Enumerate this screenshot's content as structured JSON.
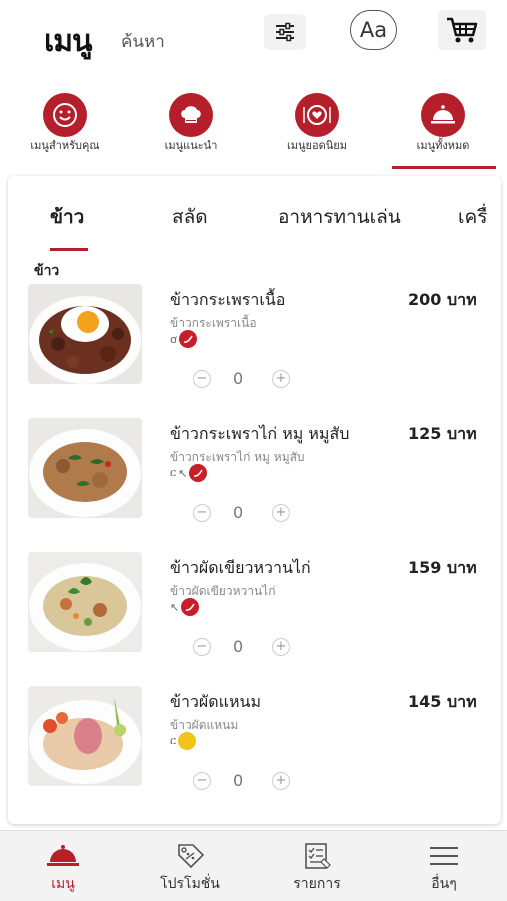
{
  "header": {
    "title": "เมนู",
    "search_label": "ค้นหา",
    "font_button_label": "Aa",
    "icons": {
      "filter": "sliders-icon",
      "font": "font-size-icon",
      "cart": "shopping-cart-icon"
    }
  },
  "categories": [
    {
      "label": "เมนูสำหรับคุณ",
      "icon": "smile-icon"
    },
    {
      "label": "เมนูแนะนำ",
      "icon": "chef-hat-icon"
    },
    {
      "label": "เมนูยอดนิยม",
      "icon": "heart-plate-icon"
    },
    {
      "label": "เมนูทั้งหมด",
      "icon": "cloche-icon",
      "active": true
    }
  ],
  "subtabs": [
    "ข้าว",
    "สลัด",
    "อาหารทานเล่น",
    "เครื่"
  ],
  "active_subtab": "ข้าว",
  "section_title": "ข้าว",
  "items": [
    {
      "name": "ข้าวกระเพราเนื้อ",
      "description": "ข้าวกระเพราเนื้อ",
      "price": "200 บาท",
      "quantity": "0",
      "tags": [
        "garlic",
        "chili"
      ]
    },
    {
      "name": "ข้าวกระเพราไก่ หมู หมูสับ",
      "description": "ข้าวกระเพราไก่ หมู หมูสับ",
      "price": "125 บาท",
      "quantity": "0",
      "tags": [
        "chicken",
        "basil",
        "chili"
      ]
    },
    {
      "name": "ข้าวผัดเขียวหวานไก่",
      "description": "ข้าวผัดเขียวหวานไก่",
      "price": "159 บาท",
      "quantity": "0",
      "tags": [
        "basil",
        "chili"
      ]
    },
    {
      "name": "ข้าวผัดแหนม",
      "description": "ข้าวผัดแหนม",
      "price": "145 บาท",
      "quantity": "0",
      "tags": [
        "chicken",
        "mild"
      ]
    }
  ],
  "bottom_nav": [
    {
      "label": "เมนู",
      "icon": "cloche-icon",
      "active": true
    },
    {
      "label": "โปรโมชั่น",
      "icon": "coupon-icon"
    },
    {
      "label": "รายการ",
      "icon": "checklist-icon"
    },
    {
      "label": "อื่นๆ",
      "icon": "hamburger-menu-icon"
    }
  ],
  "colors": {
    "accent": "#b41f2b",
    "chili": "#c71e2a",
    "mild": "#f0c419"
  }
}
